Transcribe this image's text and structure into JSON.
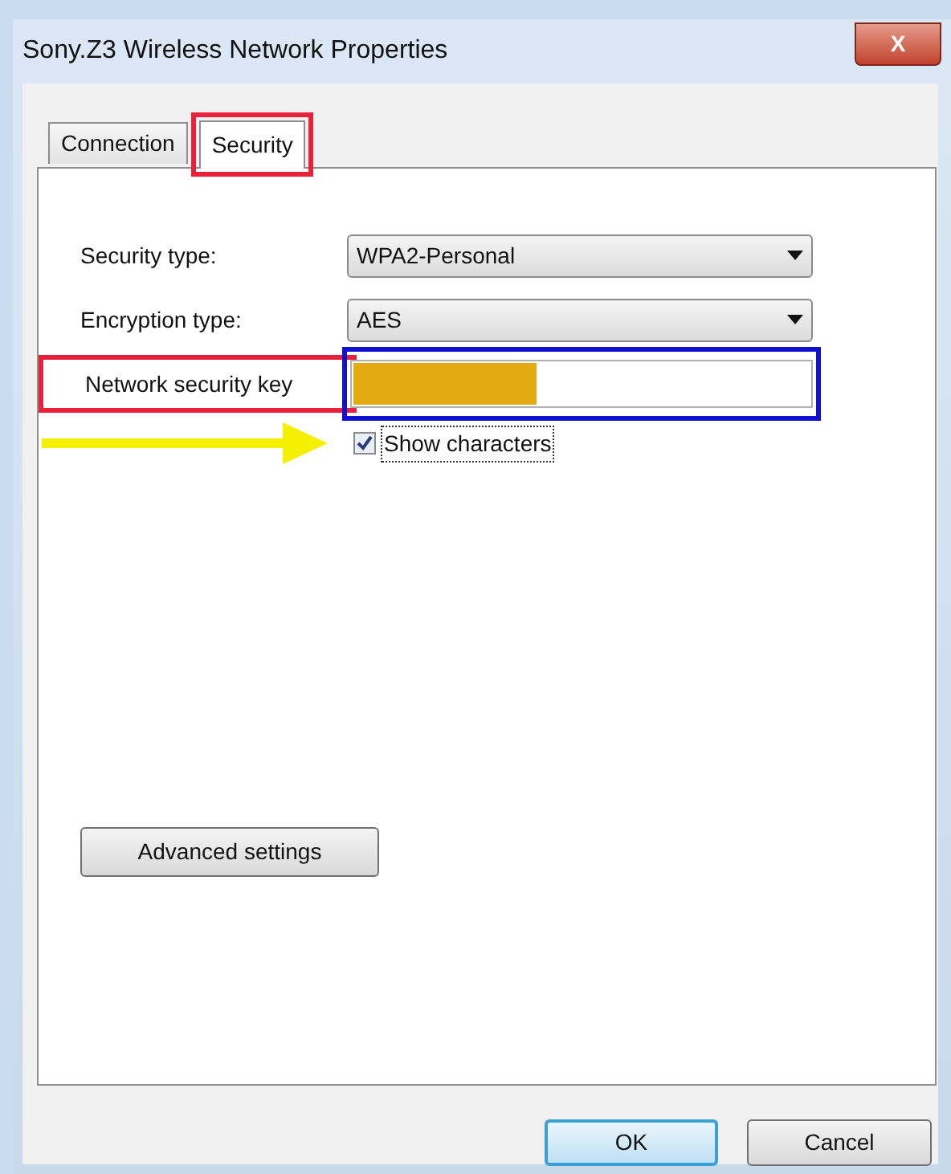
{
  "window": {
    "title": "Sony.Z3 Wireless Network Properties",
    "close": "X"
  },
  "tabs": [
    {
      "label": "Connection",
      "selected": false
    },
    {
      "label": "Security",
      "selected": true,
      "highlight": {
        "color": "#e8203c"
      }
    }
  ],
  "fields": [
    {
      "kind": "dropdown",
      "label": "Security type:",
      "value": "WPA2-Personal"
    },
    {
      "kind": "dropdown",
      "label": "Encryption type:",
      "value": "AES"
    },
    {
      "kind": "text",
      "label": "Network security key",
      "redacted": true,
      "label_highlight": {
        "color": "#e8203c"
      },
      "field_highlight": {
        "color": "#1010d0"
      }
    }
  ],
  "show_characters": {
    "label": "Show characters",
    "checked": true,
    "pointer": {
      "color": "#f5f000"
    }
  },
  "advanced_button": "Advanced settings",
  "buttons": [
    {
      "label": "OK",
      "default": true
    },
    {
      "label": "Cancel",
      "default": false
    }
  ]
}
